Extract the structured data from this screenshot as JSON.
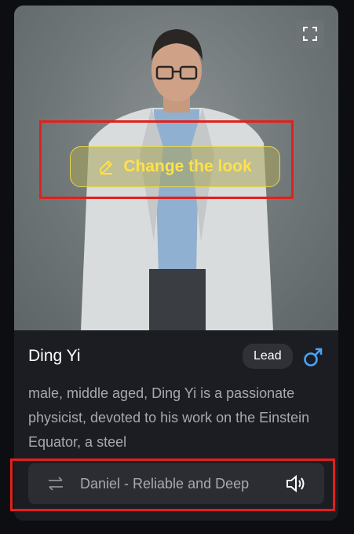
{
  "character": {
    "name": "Ding Yi",
    "role_badge": "Lead",
    "gender_icon": "male-icon",
    "description": "male, middle aged, Ding Yi is a passionate physicist, devoted to his work on the Einstein Equator, a steel"
  },
  "portrait": {
    "change_look_label": "Change the look",
    "edit_icon": "pencil-icon",
    "expand_icon": "expand-icon"
  },
  "voice": {
    "name": "Daniel - Reliable and Deep",
    "switch_icon": "swap-icon",
    "play_icon": "speaker-icon"
  },
  "colors": {
    "accent_yellow": "#ffe14a",
    "gender_blue": "#4aa3f5",
    "annotation_red": "#e3201b",
    "card_bg": "#1c1d22"
  }
}
